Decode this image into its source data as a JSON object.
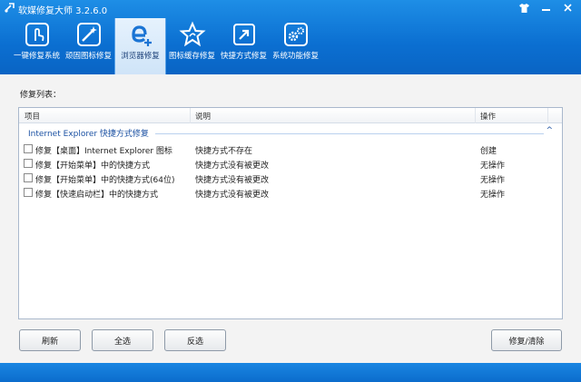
{
  "window": {
    "title": "软媒修复大师 3.2.6.0",
    "accent": "#0b6fd1"
  },
  "toolbar": {
    "items": [
      {
        "label": "一键修复系统",
        "icon": "hand-touch-icon"
      },
      {
        "label": "顽固图标修复",
        "icon": "wand-icon"
      },
      {
        "label": "浏览器修复",
        "icon": "ie-plus-icon"
      },
      {
        "label": "图标缓存修复",
        "icon": "star-icon"
      },
      {
        "label": "快捷方式修复",
        "icon": "shortcut-icon"
      },
      {
        "label": "系统功能修复",
        "icon": "gears-icon"
      }
    ]
  },
  "content": {
    "list_label": "修复列表：",
    "columns": {
      "item": "项目",
      "desc": "说明",
      "action": "操作"
    },
    "group_title": "Internet Explorer 快捷方式修复",
    "group_toggle": "^",
    "rows": [
      {
        "item": "修复【桌面】Internet Explorer 图标",
        "desc": "快捷方式不存在",
        "action": "创建"
      },
      {
        "item": "修复【开始菜单】中的快捷方式",
        "desc": "快捷方式没有被更改",
        "action": "无操作"
      },
      {
        "item": "修复【开始菜单】中的快捷方式(64位)",
        "desc": "快捷方式没有被更改",
        "action": "无操作"
      },
      {
        "item": "修复【快速启动栏】中的快捷方式",
        "desc": "快捷方式没有被更改",
        "action": "无操作"
      }
    ]
  },
  "buttons": {
    "refresh": "刷新",
    "select_all": "全选",
    "invert": "反选",
    "repair": "修复/清除"
  }
}
